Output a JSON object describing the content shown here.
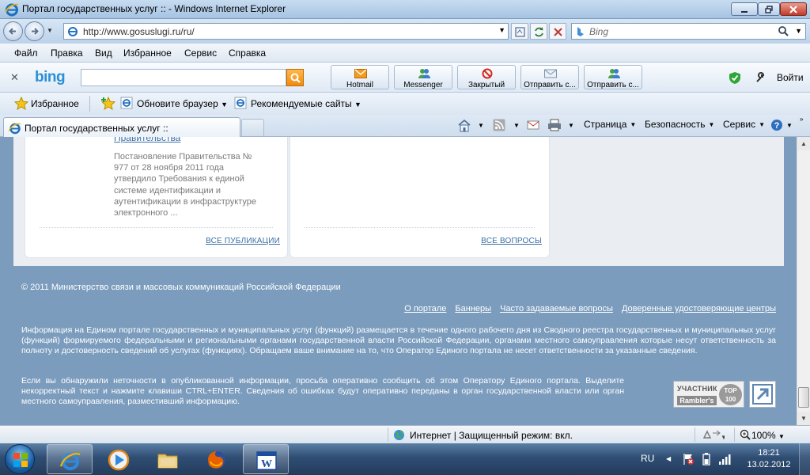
{
  "window": {
    "title": "Портал государственных услуг :: - Windows Internet Explorer"
  },
  "address": {
    "url": "http://www.gosuslugi.ru/ru/",
    "search_placeholder": "Bing"
  },
  "menu": [
    "Файл",
    "Правка",
    "Вид",
    "Избранное",
    "Сервис",
    "Справка"
  ],
  "bing_toolbar": {
    "logo": "bing",
    "buttons": [
      "Hotmail",
      "Messenger",
      "Закрытый",
      "Отправить с...",
      "Отправить с..."
    ],
    "login": "Войти"
  },
  "favorites_bar": {
    "favorites": "Избранное",
    "update_browser": "Обновите браузер",
    "recommended": "Рекомендуемые сайты"
  },
  "tab": {
    "title": "Портал государственных услуг ::"
  },
  "command_bar": {
    "page": "Страница",
    "security": "Безопасность",
    "service": "Сервис"
  },
  "content": {
    "pubs_card": {
      "link_tail": "Правительства",
      "description": "Постановление Правительства № 977 от 28 ноября 2011 года утвердило Требования к единой системе идентификации и аутентификации в инфраструктуре электронного ...",
      "all_link": "ВСЕ ПУБЛИКАЦИИ"
    },
    "questions_card": {
      "all_link": "ВСЕ ВОПРОСЫ"
    },
    "copyright": "© 2011 Министерство связи и массовых коммуникаций Российской Федерации",
    "footer_links": [
      "О портале",
      "Баннеры",
      "Часто задаваемые вопросы",
      "Доверенные удостоверяющие центры"
    ],
    "info_text": "Информация на Едином портале государственных и муниципальных услуг (функций) размещается в течение одного рабочего дня из Сводного реестра государственных и муниципальных услуг (функций) формируемого федеральными и региональными органами государственной власти Российской Федерации, органами местного самоуправления которые несут ответственность за полноту и достоверность сведений об услугах (функциях). Обращаем ваше внимание на то, что Оператор Единого портала не несет ответственности за указанные сведения.",
    "error_text": "Если вы обнаружили неточности в опубликованной информации, просьба оперативно сообщить об этом Оператору Единого портала. Выделите некорректный текст и нажмите клавиши CTRL+ENTER. Сведения об ошибках будут оперативно переданы в орган государственной власти или орган местного самоуправления, разместивший информацию.",
    "rambler": {
      "line1": "УЧАСТНИК",
      "line2": "Rambler's",
      "badge": "TOP 100"
    }
  },
  "status_bar": {
    "zone": "Интернет | Защищенный режим: вкл.",
    "zoom": "100%"
  },
  "taskbar": {
    "lang": "RU",
    "time": "18:21",
    "date": "13.02.2012"
  },
  "colors": {
    "content_bg": "#7b9cbd",
    "link": "#3a6ea5",
    "bing": "#2b8fd6"
  }
}
